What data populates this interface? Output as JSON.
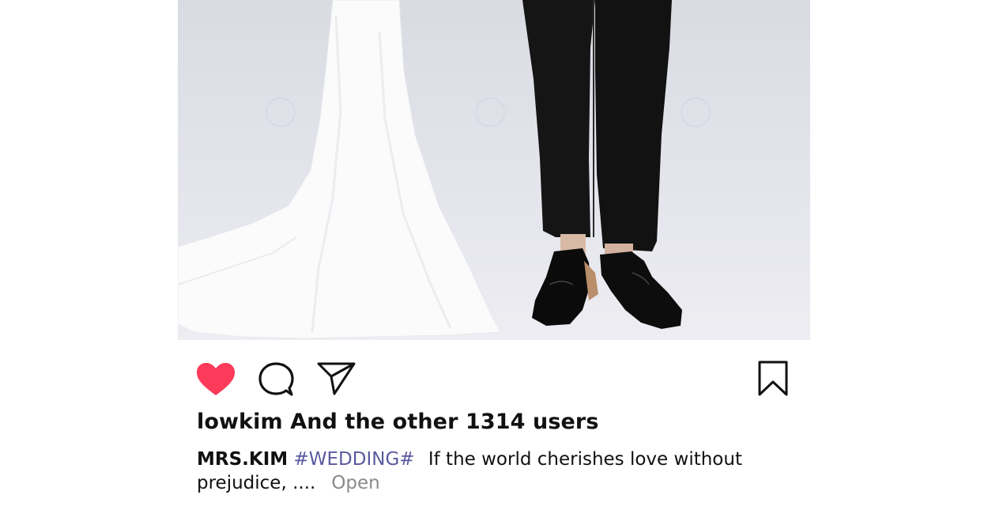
{
  "post": {
    "image": {
      "alt_subject": "bride-white-gown-and-groom-black-suit"
    },
    "actions": {
      "like_icon": "heart-filled-icon",
      "comment_icon": "comment-bubble-icon",
      "share_icon": "paper-plane-icon",
      "save_icon": "bookmark-icon",
      "liked_color": "#fd3a5a"
    },
    "likes_text": "lowkim And the other 1314 users",
    "caption": {
      "username": "MRS.KIM",
      "hashtag": "#WEDDING#",
      "text": "If the world cherishes love without prejudice, ....",
      "more_label": "Open"
    }
  }
}
